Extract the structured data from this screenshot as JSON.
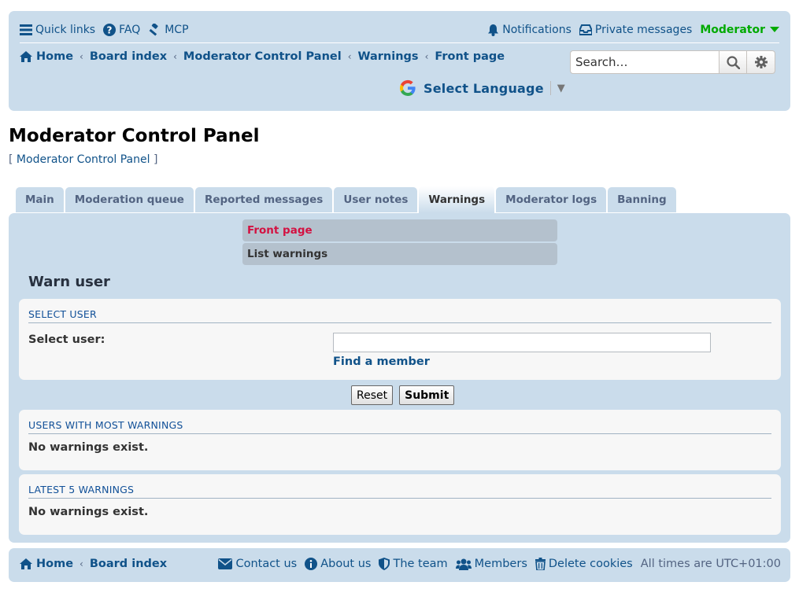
{
  "nav": {
    "quick_links": "Quick links",
    "faq": "FAQ",
    "mcp": "MCP",
    "notifications": "Notifications",
    "private_messages": "Private messages",
    "user": "Moderator"
  },
  "breadcrumbs": [
    "Home",
    "Board index",
    "Moderator Control Panel",
    "Warnings",
    "Front page"
  ],
  "search": {
    "placeholder": "Search…"
  },
  "language": {
    "label": "Select Language"
  },
  "page": {
    "title": "Moderator Control Panel",
    "subtitle": "Moderator Control Panel"
  },
  "tabs": [
    "Main",
    "Moderation queue",
    "Reported messages",
    "User notes",
    "Warnings",
    "Moderator logs",
    "Banning"
  ],
  "active_tab": "Warnings",
  "subnav": {
    "current": "Front page",
    "other": "List warnings"
  },
  "warn": {
    "heading": "Warn user",
    "fieldset_title": "SELECT USER",
    "select_label": "Select user:",
    "select_value": "",
    "find_member": "Find a member",
    "reset": "Reset",
    "submit": "Submit"
  },
  "most_warnings": {
    "title": "USERS WITH MOST WARNINGS",
    "message": "No warnings exist."
  },
  "latest_warnings": {
    "title": "LATEST 5 WARNINGS",
    "message": "No warnings exist."
  },
  "footer": {
    "home": "Home",
    "board_index": "Board index",
    "contact": "Contact us",
    "about": "About us",
    "team": "The team",
    "members": "Members",
    "delete_cookies": "Delete cookies",
    "timezone": "All times are UTC+01:00"
  },
  "colors": {
    "panel": "#cadceb",
    "link": "#105289",
    "current": "#d31141",
    "user": "#00aa00"
  }
}
